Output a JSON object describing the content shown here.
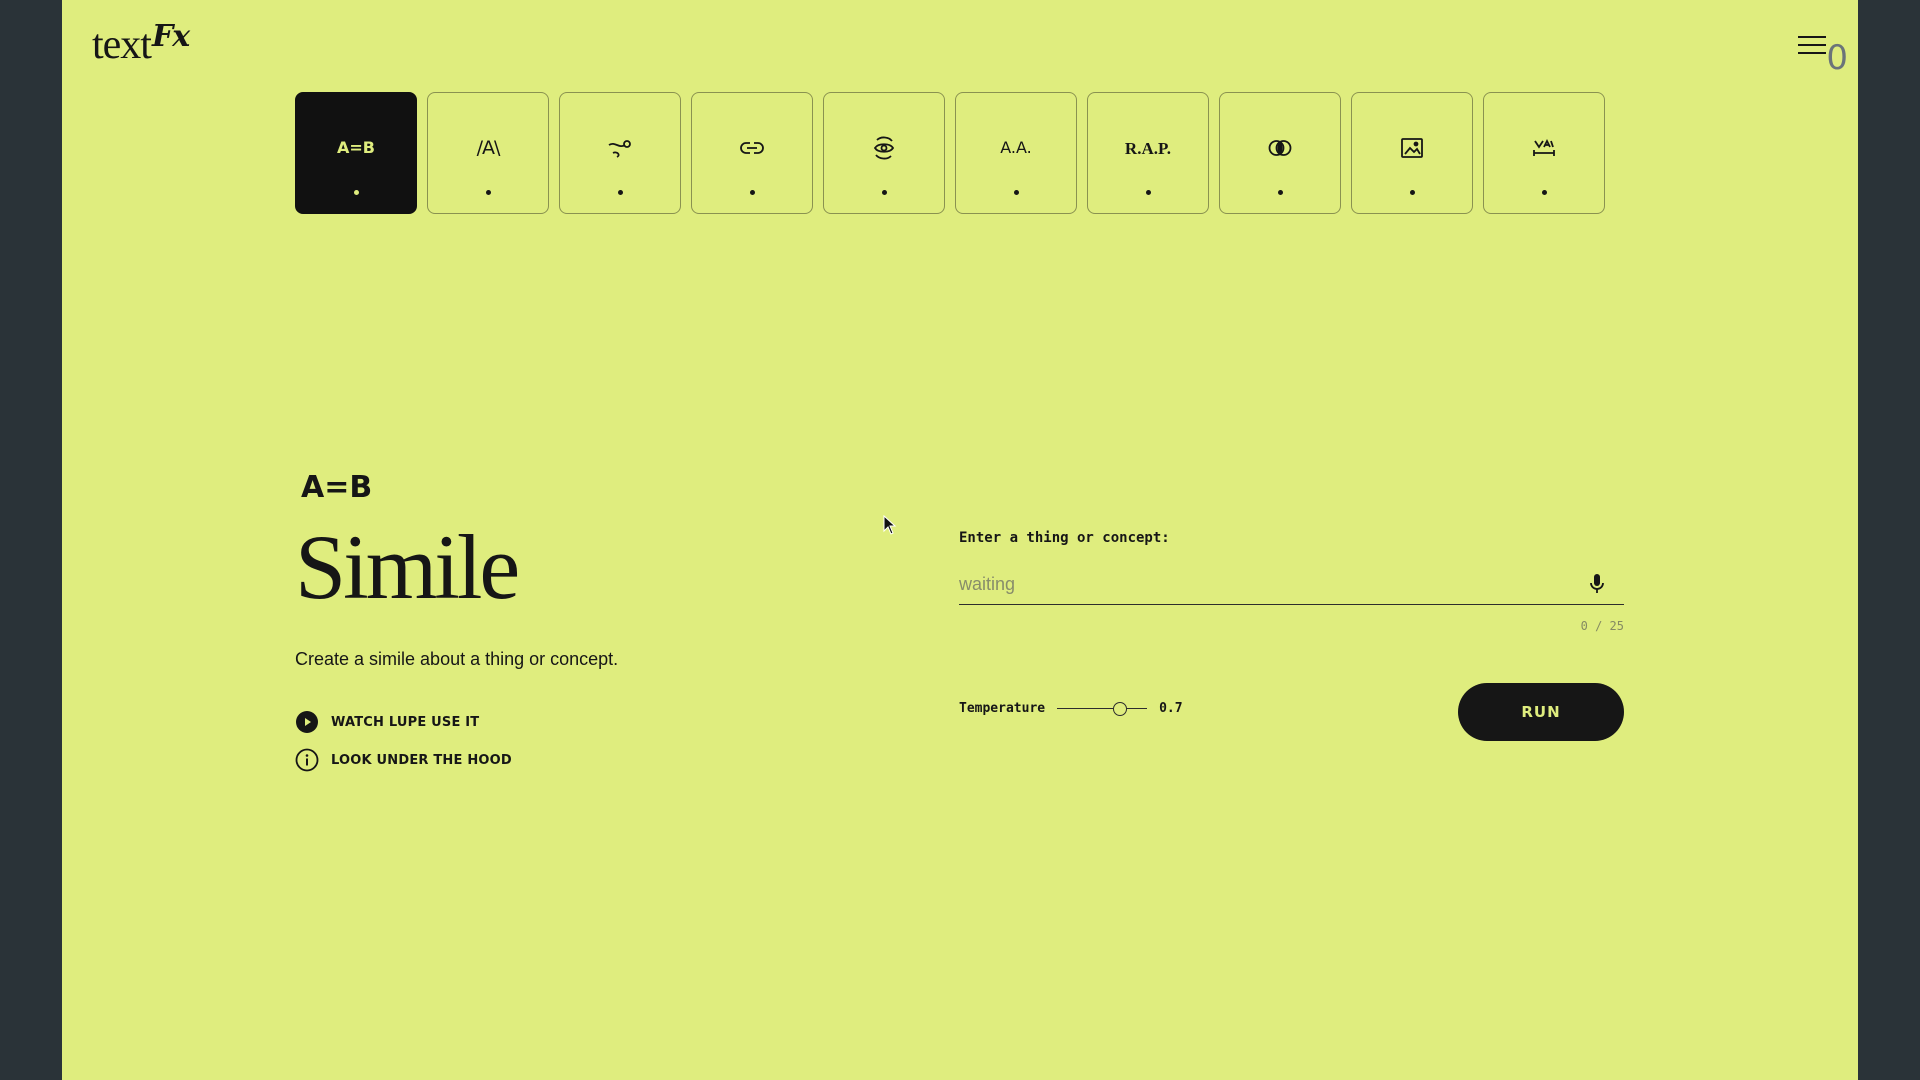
{
  "app": {
    "logo_text": "text",
    "logo_fx": "Fx",
    "side_digit": "0",
    "menu_icon": "hamburger-menu-icon",
    "colors": {
      "background": "#dfed7e",
      "frame": "#2a3338",
      "ink": "#161616"
    }
  },
  "tools": [
    {
      "name": "simile",
      "glyph": "A=B",
      "icon": "simile-icon",
      "active": true
    },
    {
      "name": "explode",
      "glyph": "/A\\",
      "icon": "explode-icon",
      "active": false
    },
    {
      "name": "unexpect",
      "glyph": "",
      "icon": "unexpect-icon",
      "active": false
    },
    {
      "name": "chain",
      "glyph": "",
      "icon": "chain-link-icon",
      "active": false
    },
    {
      "name": "pov",
      "glyph": "",
      "icon": "eye-rotate-icon",
      "active": false
    },
    {
      "name": "alliteration",
      "glyph": "A.A.",
      "icon": "alliteration-icon",
      "active": false
    },
    {
      "name": "acronym",
      "glyph": "R.A.P.",
      "icon": "acronym-icon",
      "active": false
    },
    {
      "name": "fuse",
      "glyph": "",
      "icon": "fuse-circles-icon",
      "active": false
    },
    {
      "name": "scene",
      "glyph": "",
      "icon": "image-icon",
      "active": false
    },
    {
      "name": "unfold",
      "glyph": "",
      "icon": "unfold-icon",
      "active": false
    }
  ],
  "main": {
    "code": "A=B",
    "title": "Simile",
    "description": "Create a simile about a thing or concept.",
    "watch_label": "WATCH LUPE USE IT",
    "watch_icon": "play-circle-icon",
    "hood_label": "LOOK UNDER THE HOOD",
    "hood_icon": "info-circle-icon"
  },
  "form": {
    "label": "Enter a thing or concept:",
    "placeholder": "waiting",
    "value": "",
    "mic_icon": "microphone-icon",
    "counter": "0 / 25",
    "temperature_label": "Temperature",
    "temperature_value": "0.7",
    "temperature_fraction": 0.7,
    "run_label": "RUN"
  }
}
